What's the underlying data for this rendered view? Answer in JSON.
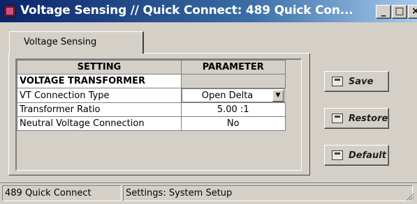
{
  "window": {
    "title": "Voltage Sensing // Quick Connect: 489 Quick Con...",
    "minimize_label": "_",
    "maximize_label": "□",
    "close_label": "×"
  },
  "tabs": [
    {
      "label": "Voltage Sensing",
      "active": true
    }
  ],
  "table": {
    "headers": [
      "SETTING",
      "PARAMETER"
    ],
    "section_title": "VOLTAGE TRANSFORMER",
    "rows": [
      {
        "setting": "VT Connection Type",
        "parameter": "Open Delta",
        "type": "dropdown"
      },
      {
        "setting": "Transformer Ratio",
        "parameter": "5.00 :1",
        "type": "text"
      },
      {
        "setting": "Neutral Voltage Connection",
        "parameter": "No",
        "type": "text"
      }
    ]
  },
  "buttons": {
    "save": "Save",
    "restore": "Restore",
    "default": "Default"
  },
  "statusbar": {
    "device": "489 Quick Connect",
    "path": "Settings: System Setup"
  },
  "icons": {
    "app": "relay-app-icon",
    "save": "save-icon",
    "restore": "restore-icon",
    "default": "default-icon",
    "dropdown": "chevron-down-icon",
    "grip": "resize-grip-icon"
  }
}
